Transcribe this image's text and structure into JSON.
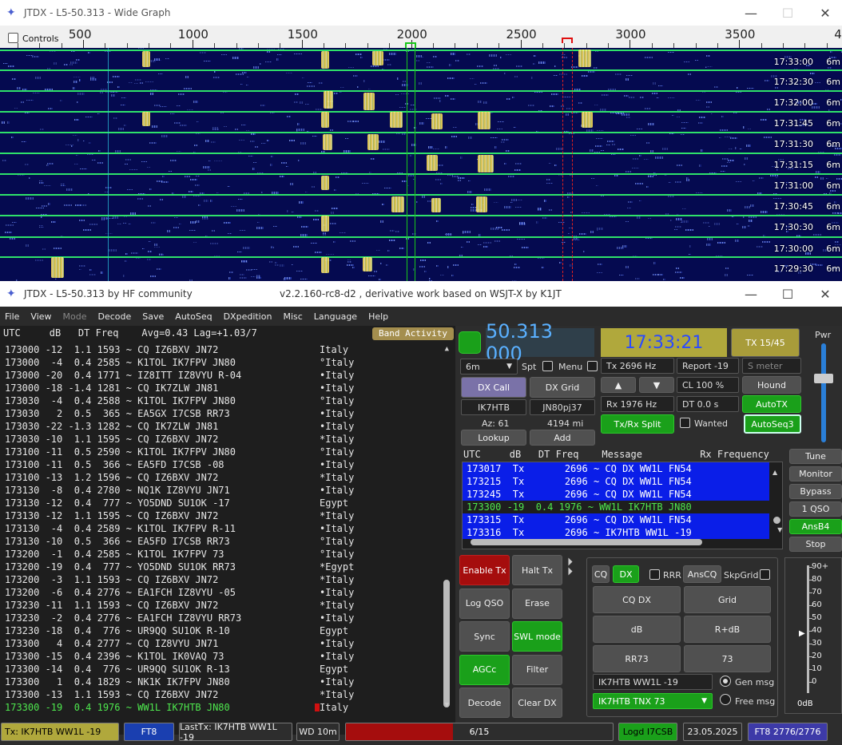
{
  "wide_graph": {
    "title": "JTDX - L5-50.313 - Wide Graph",
    "controls_label": "Controls",
    "freq_ticks": [
      "500",
      "1000",
      "1500",
      "2000",
      "2500",
      "3000",
      "3500",
      "4"
    ],
    "rows": [
      {
        "time": "17:33:00",
        "band": "6m"
      },
      {
        "time": "17:32:30",
        "band": "6m"
      },
      {
        "time": "17:32:00",
        "band": "6m"
      },
      {
        "time": "17:31:45",
        "band": "6m"
      },
      {
        "time": "17:31:30",
        "band": "6m"
      },
      {
        "time": "17:31:15",
        "band": "6m"
      },
      {
        "time": "17:31:00",
        "band": "6m"
      },
      {
        "time": "17:30:45",
        "band": "6m"
      },
      {
        "time": "17:30:30",
        "band": "6m"
      },
      {
        "time": "17:30:00",
        "band": "6m"
      },
      {
        "time": "17:29:30",
        "band": "6m"
      }
    ]
  },
  "main": {
    "title_left": "JTDX - L5-50.313  by HF community",
    "title_center": "v2.2.160-rc8-d2 , derivative work based on WSJT-X by K1JT",
    "menu": [
      "File",
      "View",
      "Mode",
      "Decode",
      "Save",
      "AutoSeq",
      "DXpedition",
      "Misc",
      "Language",
      "Help"
    ],
    "band_activity": {
      "header": "UTC     dB   DT Freq    Avg=0.43 Lag=+1.03/7",
      "button": "Band Activity",
      "lines": [
        {
          "t": "173000 -12  1.1 1593 ~ CQ IZ6BXV JN72",
          "c": "Italy"
        },
        {
          "t": "173000  -4  0.4 2585 ~ K1TOL IK7FPV JN80",
          "c": "°Italy"
        },
        {
          "t": "173000 -20  0.4 1771 ~ IZ8ITT IZ8VYU R-04",
          "c": "•Italy"
        },
        {
          "t": "173000 -18 -1.4 1281 ~ CQ IK7ZLW JN81",
          "c": "•Italy"
        },
        {
          "t": "173030  -4  0.4 2588 ~ K1TOL IK7FPV JN80",
          "c": "°Italy"
        },
        {
          "t": "173030   2  0.5  365 ~ EA5GX I7CSB RR73",
          "c": "•Italy"
        },
        {
          "t": "173030 -22 -1.3 1282 ~ CQ IK7ZLW JN81",
          "c": "•Italy"
        },
        {
          "t": "173030 -10  1.1 1595 ~ CQ IZ6BXV JN72",
          "c": "*Italy"
        },
        {
          "t": "173100 -11  0.5 2590 ~ K1TOL IK7FPV JN80",
          "c": "°Italy"
        },
        {
          "t": "173100 -11  0.5  366 ~ EA5FD I7CSB -08",
          "c": "•Italy"
        },
        {
          "t": "173100 -13  1.2 1596 ~ CQ IZ6BXV JN72",
          "c": "*Italy"
        },
        {
          "t": "173130  -8  0.4 2780 ~ NQ1K IZ8VYU JN71",
          "c": "•Italy"
        },
        {
          "t": "173130 -12  0.4  777 ~ YO5DND SU1OK -17",
          "c": "Egypt"
        },
        {
          "t": "173130 -12  1.1 1595 ~ CQ IZ6BXV JN72",
          "c": "*Italy"
        },
        {
          "t": "173130  -4  0.4 2589 ~ K1TOL IK7FPV R-11",
          "c": "•Italy"
        },
        {
          "t": "173130 -10  0.5  366 ~ EA5FD I7CSB RR73",
          "c": "°Italy"
        },
        {
          "t": "173200  -1  0.4 2585 ~ K1TOL IK7FPV 73",
          "c": "°Italy"
        },
        {
          "t": "173200 -19  0.4  777 ~ YO5DND SU1OK RR73",
          "c": "*Egypt"
        },
        {
          "t": "173200  -3  1.1 1593 ~ CQ IZ6BXV JN72",
          "c": "*Italy"
        },
        {
          "t": "173200  -6  0.4 2776 ~ EA1FCH IZ8VYU -05",
          "c": "•Italy"
        },
        {
          "t": "173230 -11  1.1 1593 ~ CQ IZ6BXV JN72",
          "c": "*Italy"
        },
        {
          "t": "173230  -2  0.4 2776 ~ EA1FCH IZ8VYU RR73",
          "c": "•Italy"
        },
        {
          "t": "173230 -18  0.4  776 ~ UR9QQ SU1OK R-10",
          "c": "Egypt"
        },
        {
          "t": "173300   4  0.4 2777 ~ CQ IZ8VYU JN71",
          "c": "•Italy"
        },
        {
          "t": "173300 -15  0.4 2396 ~ K1TOL IK0VAQ 73",
          "c": "•Italy"
        },
        {
          "t": "173300 -14  0.4  776 ~ UR9QQ SU1OK R-13",
          "c": "Egypt"
        },
        {
          "t": "173300   1  0.4 1829 ~ NK1K IK7FPV JN80",
          "c": "•Italy"
        },
        {
          "t": "173300 -13  1.1 1593 ~ CQ IZ6BXV JN72",
          "c": "*Italy"
        },
        {
          "t": "173300 -19  0.4 1976 ~ WW1L IK7HTB JN80",
          "c": "Italy",
          "hl": true
        }
      ]
    },
    "freq": "50.313 000",
    "clock": "17:33:21",
    "tx_period": "TX 15/45",
    "band": "6m",
    "spt": "Spt",
    "menu_chk": "Menu",
    "tx_hz": "Tx  2696  Hz",
    "report": "Report -19",
    "smeter": "S meter",
    "rx_hz": "Rx  1976  Hz",
    "cl": "CL  100 %",
    "dt": "DT  0.0 s",
    "hound": "Hound",
    "autotx": "AutoTX",
    "wanted": "Wanted",
    "autoseq3": "AutoSeq3",
    "txrx_split": "Tx/Rx Split",
    "dx_call_btn": "DX Call",
    "dx_grid_btn": "DX Grid",
    "dx_call": "IK7HTB",
    "dx_grid": "JN80pj37",
    "az": "Az: 61",
    "dist": "4194 mi",
    "lookup": "Lookup",
    "add": "Add",
    "pwr": "Pwr",
    "rx_header": "UTC     dB   DT Freq    Message          Rx Frequency",
    "rx_lines": [
      {
        "t": "173017  Tx       2696 ~ CQ DX WW1L FN54",
        "k": "tx"
      },
      {
        "t": "173215  Tx       2696 ~ CQ DX WW1L FN54",
        "k": "tx"
      },
      {
        "t": "173245  Tx       2696 ~ CQ DX WW1L FN54",
        "k": "tx"
      },
      {
        "t": "173300 -19  0.4 1976 ~ WW1L IK7HTB JN80",
        "k": "rx"
      },
      {
        "t": "173315  Tx       2696 ~ CQ DX WW1L FN54",
        "k": "tx"
      },
      {
        "t": "173316  Tx       2696 ~ IK7HTB WW1L -19",
        "k": "tx"
      }
    ],
    "side_buttons": [
      "Tune",
      "Monitor",
      "Bypass",
      "1 QSO",
      "AnsB4",
      "Stop"
    ],
    "left_buttons": [
      "Enable Tx",
      "Halt Tx",
      "Log QSO",
      "Erase",
      "Sync",
      "SWL mode",
      "AGCc",
      "Filter",
      "Decode",
      "Clear DX"
    ],
    "cq_btn": "CQ",
    "dx_btn": "DX",
    "rrr": "RRR",
    "anscq": "AnsCQ",
    "skpgrid": "SkpGrid",
    "msg_buttons": [
      "CQ DX",
      "Grid",
      "dB",
      "R+dB",
      "RR73",
      "73"
    ],
    "gen_msg_field": "IK7HTB WW1L -19",
    "gen_msg": "Gen msg",
    "free_msg_field": "IK7HTB TNX 73",
    "free_msg": "Free msg",
    "meter_labels": [
      "90+",
      "80",
      "70",
      "60",
      "50",
      "40",
      "30",
      "20",
      "10",
      "0"
    ],
    "meter_db": "0dB",
    "status": {
      "tx": "Tx: IK7HTB WW1L -19",
      "mode": "FT8",
      "last_tx": "LastTx: IK7HTB WW1L -19",
      "wd": "WD 10m",
      "progress": "6/15",
      "progress_fraction": 0.4,
      "logd": "Logd I7CSB",
      "date": "23.05.2025",
      "ft8": "FT8  2776/2776"
    }
  }
}
